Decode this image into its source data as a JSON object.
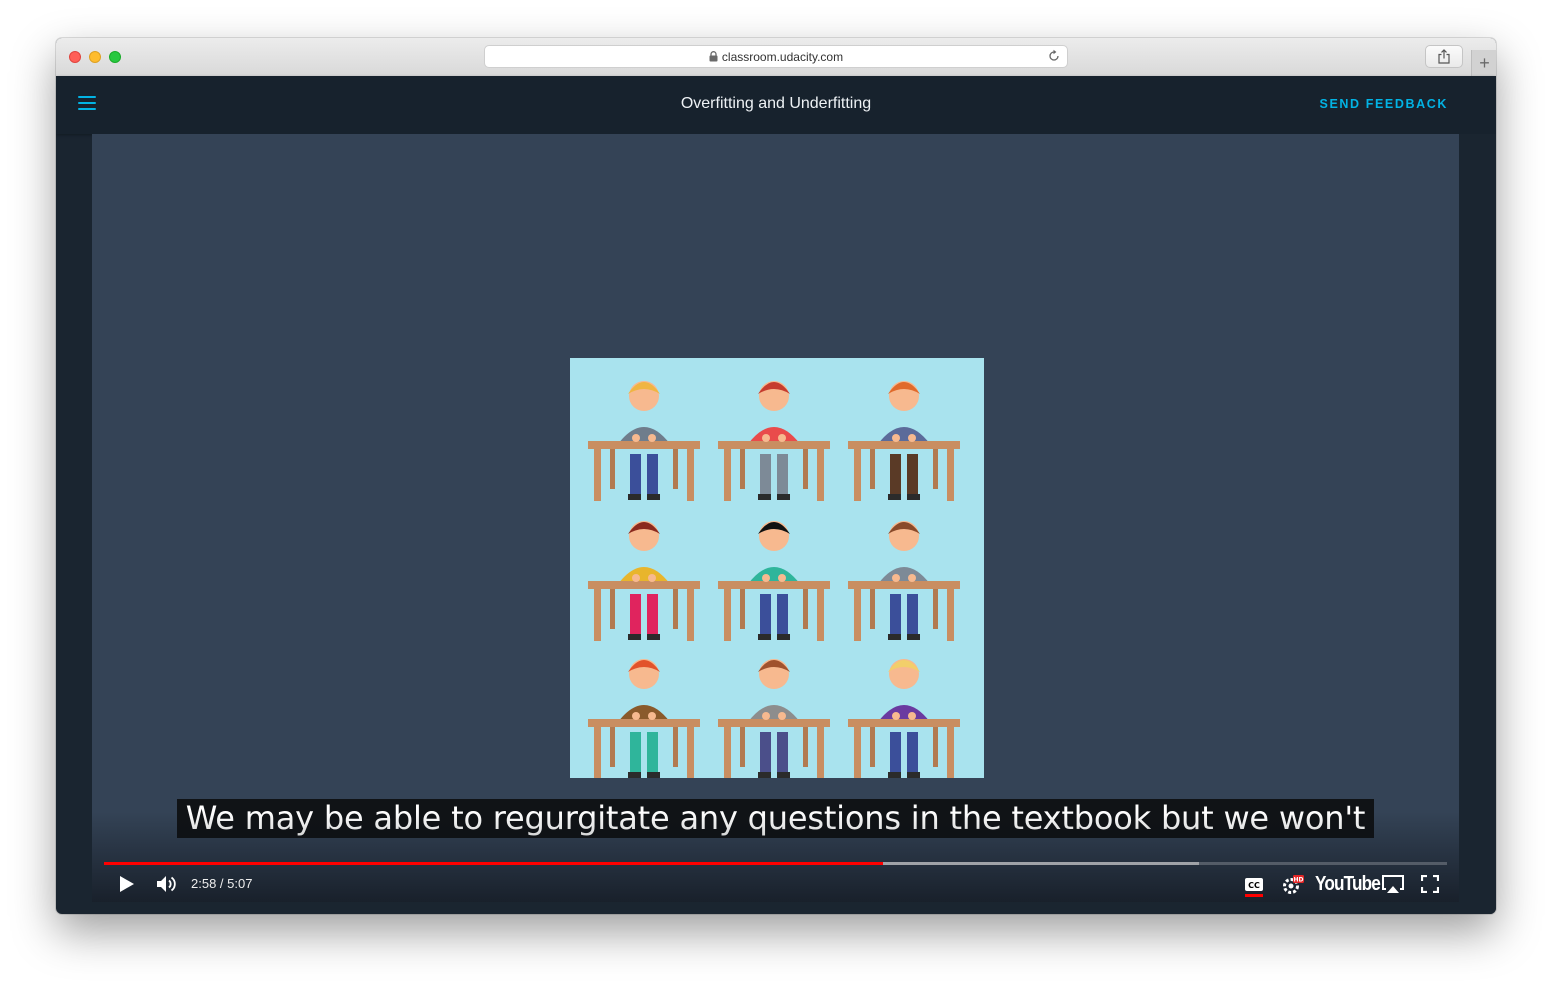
{
  "browser": {
    "url": "classroom.udacity.com"
  },
  "header": {
    "title": "Overfitting and Underfitting",
    "feedback_label": "SEND FEEDBACK"
  },
  "video": {
    "caption": "We may be able to regurgitate any questions in the textbook but we won't",
    "time_display": "2:58 / 5:07",
    "current_time": "2:58",
    "duration": "5:07",
    "played_fraction": 0.58,
    "buffered_fraction": 0.815,
    "brand": "YouTube",
    "accent_color": "#ff0000",
    "icons": [
      "play-icon",
      "volume-icon",
      "captions-icon",
      "settings-hd-icon",
      "airplay-icon",
      "fullscreen-icon"
    ]
  },
  "colors": {
    "header_bg": "#17222d",
    "video_bg": "#344356",
    "link_accent": "#02b3e4"
  }
}
